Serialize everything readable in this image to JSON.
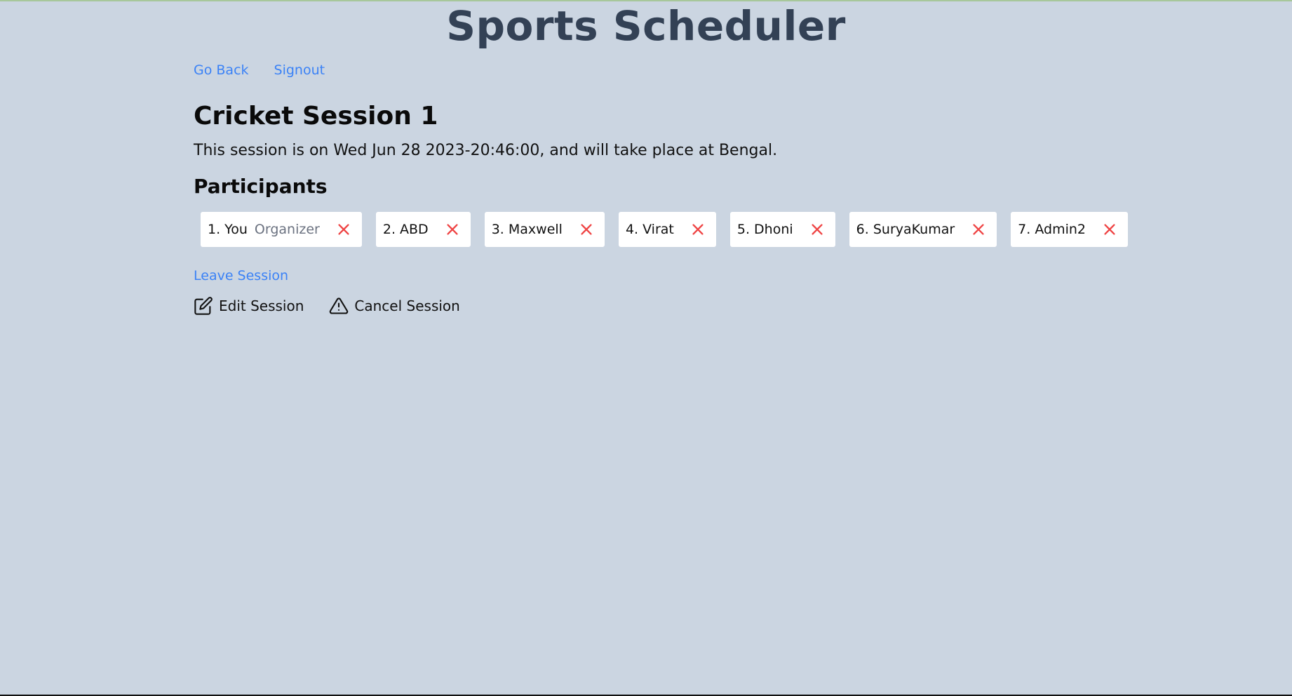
{
  "app": {
    "title": "Sports Scheduler"
  },
  "nav": {
    "go_back": "Go Back",
    "signout": "Signout"
  },
  "session": {
    "title": "Cricket Session 1",
    "description": "This session is on Wed Jun 28 2023-20:46:00, and will take place at Bengal."
  },
  "participants": {
    "heading": "Participants",
    "items": [
      {
        "label": "1. You",
        "role": "Organizer"
      },
      {
        "label": "2. ABD",
        "role": ""
      },
      {
        "label": "3. Maxwell",
        "role": ""
      },
      {
        "label": "4. Virat",
        "role": ""
      },
      {
        "label": "5. Dhoni",
        "role": ""
      },
      {
        "label": "6. SuryaKumar",
        "role": ""
      },
      {
        "label": "7. Admin2",
        "role": ""
      }
    ]
  },
  "actions": {
    "leave": "Leave Session",
    "edit": "Edit Session",
    "cancel": "Cancel Session"
  },
  "icons": {
    "remove": "close-icon",
    "edit": "edit-icon",
    "cancel": "warning-icon"
  },
  "colors": {
    "background": "#cbd5e1",
    "title": "#334155",
    "link": "#3b82f6",
    "remove": "#ef4444"
  }
}
